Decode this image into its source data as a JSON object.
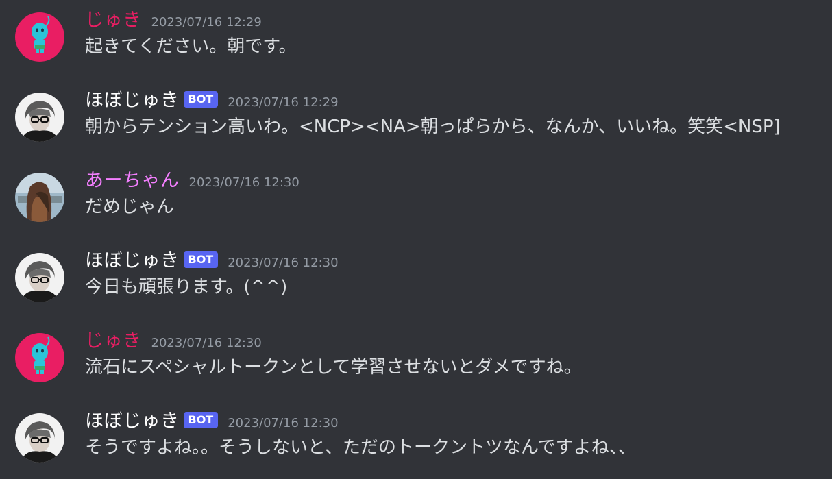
{
  "colors": {
    "background": "#313338",
    "text": "#dbdee1",
    "timestamp": "#949ba4",
    "bot_tag": "#5865f2",
    "user_juki": "#e91e63",
    "user_achan": "#f47fff",
    "user_bot": "#ffffff"
  },
  "messages": [
    {
      "author": "じゅき",
      "avatar": "blue-character-avatar-icon",
      "bot_tag": "",
      "timestamp": "2023/07/16 12:29",
      "content": "起きてください。朝です。"
    },
    {
      "author": "ほぼじゅき",
      "avatar": "person-photo-avatar-icon",
      "bot_tag": "BOT",
      "timestamp": "2023/07/16 12:29",
      "content": "朝からテンション高いわ。<NCP><NA>朝っぱらから、なんか、いいね。笑笑<NSP]"
    },
    {
      "author": "あーちゃん",
      "avatar": "photo-avatar-icon",
      "bot_tag": "",
      "timestamp": "2023/07/16 12:30",
      "content": "だめじゃん"
    },
    {
      "author": "ほぼじゅき",
      "avatar": "person-photo-avatar-icon",
      "bot_tag": "BOT",
      "timestamp": "2023/07/16 12:30",
      "content": "今日も頑張ります。(^^)"
    },
    {
      "author": "じゅき",
      "avatar": "blue-character-avatar-icon",
      "bot_tag": "",
      "timestamp": "2023/07/16 12:30",
      "content": "流石にスペシャルトークンとして学習させないとダメですね。"
    },
    {
      "author": "ほぼじゅき",
      "avatar": "person-photo-avatar-icon",
      "bot_tag": "BOT",
      "timestamp": "2023/07/16 12:30",
      "content": "そうですよね。。そうしないと、ただのトークントツなんですよね、、"
    }
  ]
}
